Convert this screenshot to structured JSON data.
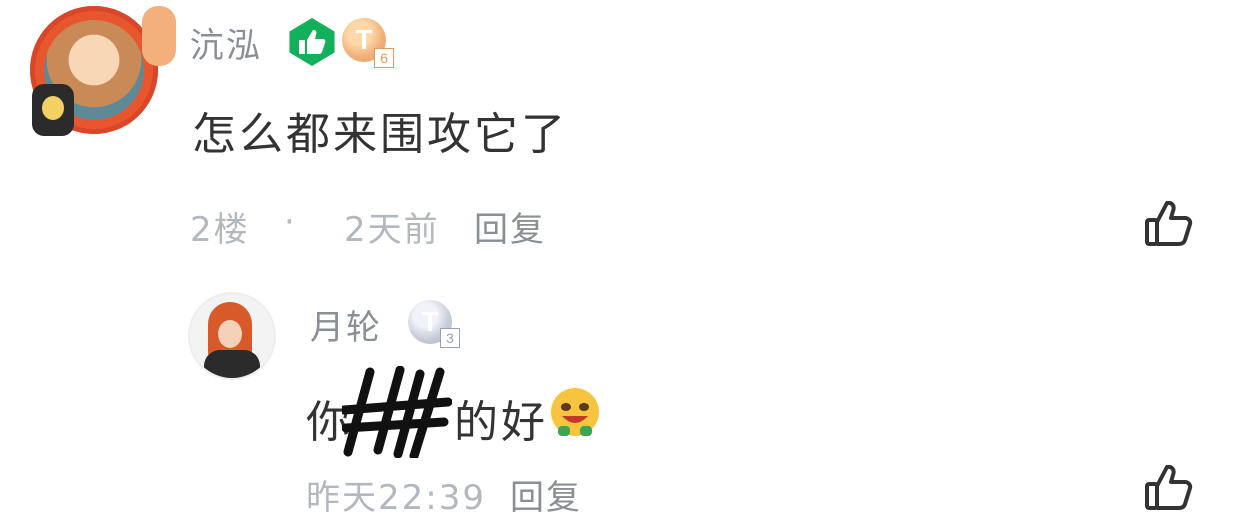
{
  "comments": [
    {
      "username": "沆泓",
      "level": "6",
      "level_badge_letter": "T",
      "text": "怎么都来围攻它了",
      "floor": "2楼",
      "separator": "·",
      "time": "2天前",
      "reply_label": "回复",
      "like_icon": "thumbs-up-outline-icon",
      "badge_icon": "thumbs-up-badge-icon"
    }
  ],
  "replies": [
    {
      "username": "月轮",
      "level": "3",
      "level_badge_letter": "T",
      "text_before": "你",
      "text_after": "的好",
      "redaction": "scribble",
      "emoji": "grinning-emoji",
      "time": "昨天22:39",
      "reply_label": "回复",
      "like_icon": "thumbs-up-outline-icon"
    }
  ],
  "colors": {
    "badge_green": "#13b05c",
    "badge_gold": "#f0b07a",
    "badge_silver": "#c8ccdb",
    "username_gray": "#8a8f96",
    "meta_gray": "#b3b8bf",
    "text_dark": "#333333"
  }
}
